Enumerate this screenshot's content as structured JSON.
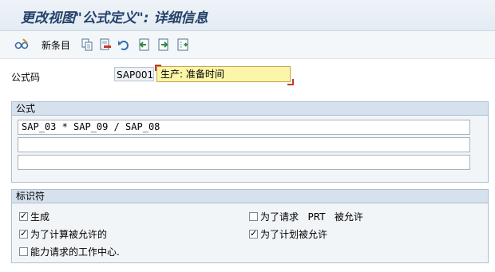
{
  "window": {
    "title": "更改视图\"公式定义\": 详细信息"
  },
  "toolbar": {
    "new_entries_label": "新条目",
    "icons": [
      "edit-glasses-icon",
      "copy-icon",
      "delete-icon",
      "undo-icon",
      "previous-entry-icon",
      "next-entry-icon",
      "select-icon"
    ]
  },
  "header_fields": {
    "formula_code_label": "公式码",
    "formula_code_value": "SAP001",
    "formula_name_value": "生产: 准备时间"
  },
  "formula_group": {
    "title": "公式",
    "lines": [
      "SAP_03 * SAP_09 / SAP_08",
      "",
      ""
    ]
  },
  "indicator_group": {
    "title": "标识符",
    "checkboxes": [
      {
        "label": "生成",
        "checked": true
      },
      {
        "label": "为了计算被允许的",
        "checked": true
      },
      {
        "label": "能力请求的工作中心.",
        "checked": false
      },
      {
        "label": "为了请求   PRT   被允许",
        "checked": false
      },
      {
        "label": "为了计划被允许",
        "checked": true
      }
    ]
  },
  "colors": {
    "title_text": "#24426a",
    "required_field_bg": "#fbf6a8",
    "group_header_bg": "#d5e1ec"
  }
}
